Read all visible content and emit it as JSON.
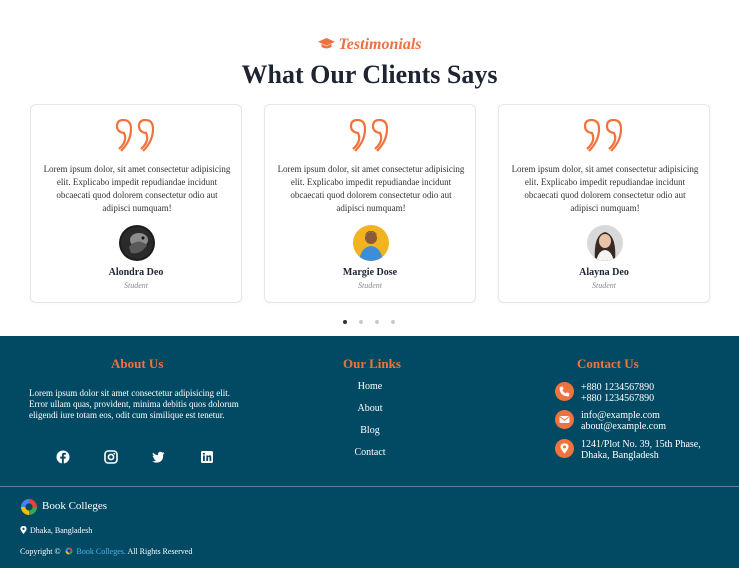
{
  "testimonials": {
    "eyebrow": "Testimonials",
    "title": "What Our Clients Says",
    "cards": [
      {
        "text": "Lorem ipsum dolor, sit amet consectetur adipisicing elit. Explicabo impedit repudiandae incidunt obcaecati quod dolorem consectetur odio aut adipisci numquam!",
        "name": "Alondra Deo",
        "role": "Student"
      },
      {
        "text": "Lorem ipsum dolor, sit amet consectetur adipisicing elit. Explicabo impedit repudiandae incidunt obcaecati quod dolorem consectetur odio aut adipisci numquam!",
        "name": "Margie Dose",
        "role": "Student"
      },
      {
        "text": "Lorem ipsum dolor, sit amet consectetur adipisicing elit. Explicabo impedit repudiandae incidunt obcaecati quod dolorem consectetur odio aut adipisci numquam!",
        "name": "Alayna Deo",
        "role": "Student"
      }
    ],
    "carousel": {
      "total": 4,
      "active": 0
    }
  },
  "footer": {
    "about": {
      "title": "About Us",
      "text": "Lorem ipsum dolor sit amet consectetur adipisicing elit. Error ullam quas, provident, minima debitis quos dolorum eligendi iure totam eos, odit cum similique est tenetur.",
      "social": [
        "facebook-icon",
        "instagram-icon",
        "twitter-icon",
        "linkedin-icon"
      ]
    },
    "links": {
      "title": "Our Links",
      "items": [
        "Home",
        "About",
        "Blog",
        "Contact"
      ]
    },
    "contact": {
      "title": "Contact Us",
      "phone1": "+880 1234567890",
      "phone2": "+880 1234567890",
      "email1": "info@example.com",
      "email2": "about@example.com",
      "address1": "1241/Plot No. 39, 15th Phase,",
      "address2": "Dhaka, Bangladesh"
    },
    "brand": "Book Colleges",
    "location": "Dhaka, Bangladesh",
    "copyright_prefix": "Copyright ©",
    "copyright_brand": "Book Colleges.",
    "copyright_suffix": "All Rights Reserved"
  },
  "colors": {
    "accent": "#f0733d",
    "footer_bg": "#024a63",
    "heading": "#1f2433",
    "link_blue": "#4fb3e8"
  }
}
